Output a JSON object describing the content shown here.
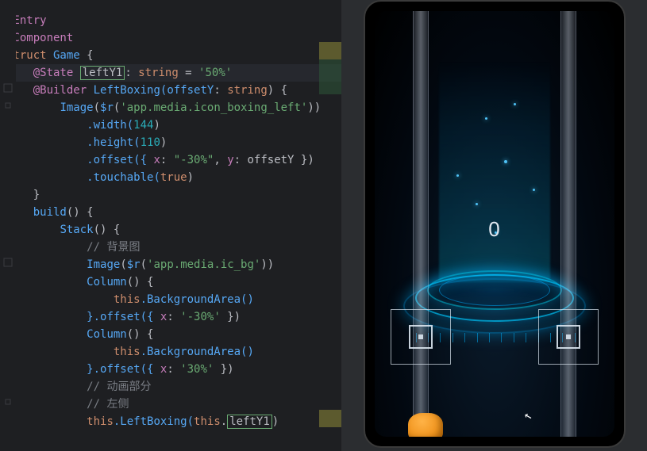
{
  "code": {
    "l1a": "@Entry",
    "l2a": "@Component",
    "l3a": "struct",
    "l3b": " Game ",
    "l3c": "{",
    "l4a": "@State",
    "l4b": "leftY1",
    "l4c": ": ",
    "l4d": "string",
    "l4e": " = ",
    "l4f": "'50%'",
    "l5a": "@Builder",
    "l5b": " LeftBoxing(",
    "l5c": "offsetY",
    "l5d": ": ",
    "l5e": "string",
    "l5f": ") {",
    "l6a": "Image",
    "l6b": "(",
    "l6c": "$r",
    "l6d": "(",
    "l6e": "'app.media.icon_boxing_left'",
    "l6f": "))",
    "l7a": ".width(",
    "l7b": "144",
    "l7c": ")",
    "l8a": ".height(",
    "l8b": "110",
    "l8c": ")",
    "l9a": ".offset({ ",
    "l9b": "x",
    "l9c": ": ",
    "l9d": "\"-30%\"",
    "l9e": ", ",
    "l9f": "y",
    "l9g": ": offsetY })",
    "l10a": ".touchable(",
    "l10b": "true",
    "l10c": ")",
    "l11a": "}",
    "l12a": "build",
    "l12b": "() {",
    "l13a": "Stack",
    "l13b": "() {",
    "l14a": "// 背景图",
    "l15a": "Image",
    "l15b": "(",
    "l15c": "$r",
    "l15d": "(",
    "l15e": "'app.media.ic_bg'",
    "l15f": "))",
    "l16a": "Column",
    "l16b": "() {",
    "l17a": "this",
    "l17b": ".BackgroundArea()",
    "l18a": "}.offset({ ",
    "l18b": "x",
    "l18c": ": ",
    "l18d": "'-30%'",
    "l18e": " })",
    "l19a": "Column",
    "l19b": "() {",
    "l20a": "this",
    "l20b": ".BackgroundArea()",
    "l21a": "}.offset({ ",
    "l21b": "x",
    "l21c": ": ",
    "l21d": "'30%'",
    "l21e": " })",
    "l22a": "// 动画部分",
    "l23a": "// 左侧",
    "l24a": "this",
    "l24b": ".LeftBoxing(",
    "l24c": "this",
    "l24d": ".",
    "l24e": "leftY1",
    "l24f": ")"
  },
  "preview": {
    "score": "0"
  }
}
